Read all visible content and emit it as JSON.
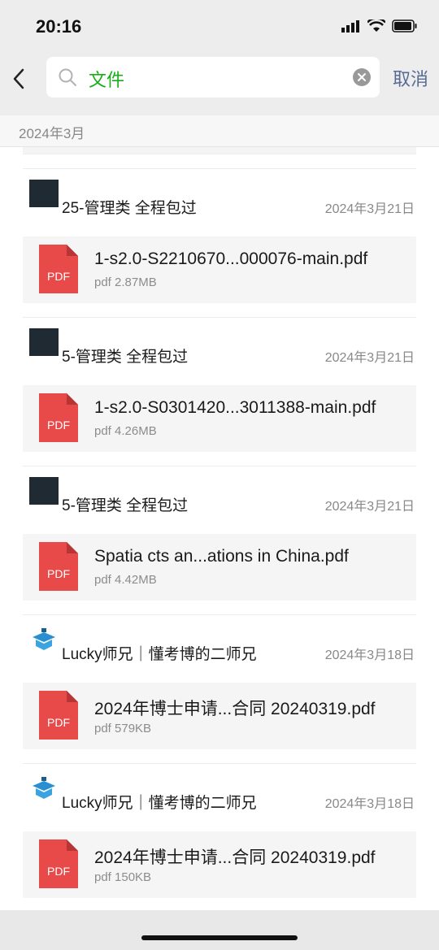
{
  "status": {
    "time": "20:16"
  },
  "search": {
    "query": "文件",
    "cancel_label": "取消"
  },
  "month_label": "2024年3月",
  "groups": [
    {
      "sender": "25-管理类 全程包过",
      "date": "2024年3月21日",
      "file_name": "1-s2.0-S2210670...000076-main.pdf",
      "file_meta": "pdf 2.87MB"
    },
    {
      "sender": "5-管理类 全程包过",
      "date": "2024年3月21日",
      "file_name": "1-s2.0-S0301420...3011388-main.pdf",
      "file_meta": "pdf 4.26MB"
    },
    {
      "sender": "5-管理类 全程包过",
      "date": "2024年3月21日",
      "file_name": "Spatia cts an...ations in China.pdf",
      "file_meta": "pdf 4.42MB"
    },
    {
      "sender": "Lucky师兄｜懂考博的二师兄",
      "date": "2024年3月18日",
      "file_name": "2024年博士申请...合同 20240319.pdf",
      "file_meta": "pdf 579KB"
    },
    {
      "sender": "Lucky师兄｜懂考博的二师兄",
      "date": "2024年3月18日",
      "file_name": "2024年博士申请...合同 20240319.pdf",
      "file_meta": "pdf 150KB"
    }
  ],
  "pdf_label": "PDF",
  "colors": {
    "accent_green": "#1aad19",
    "link_blue": "#576b95",
    "pdf_red": "#e84a4a"
  },
  "icons": {
    "back": "chevron-left-icon",
    "search": "search-icon",
    "clear": "clear-icon",
    "file": "pdf-file-icon"
  }
}
